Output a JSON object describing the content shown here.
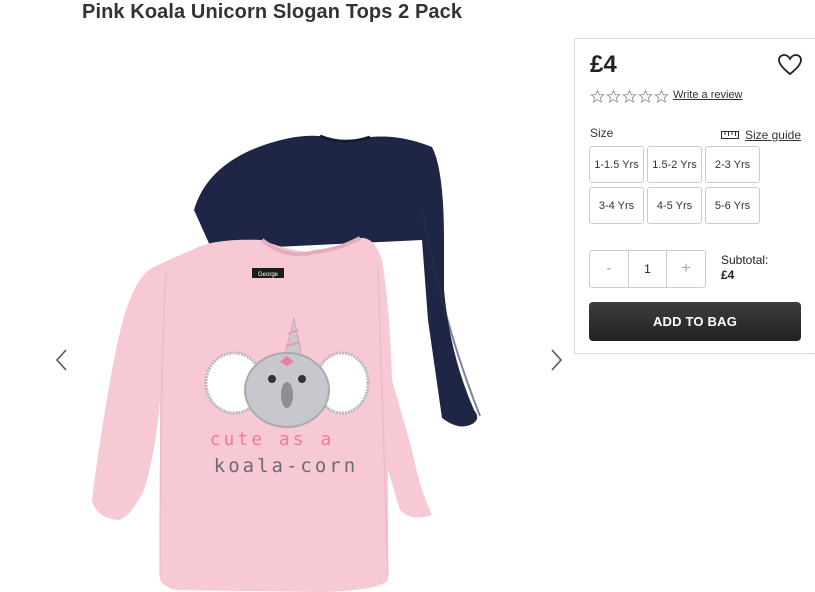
{
  "product": {
    "title": "Pink Koala Unicorn Slogan Tops 2 Pack",
    "image_alt": "Pink Koala Unicorn Slogan Tops 2 Pack",
    "print_line1": "cute as a",
    "print_line2": "koala-corn",
    "label": "George"
  },
  "gallery": {
    "prev_icon": "chevron-left-icon",
    "next_icon": "chevron-right-icon"
  },
  "panel": {
    "price": "£4",
    "wishlist_icon": "heart-icon",
    "rating_stars": 5,
    "rating_value": 0,
    "review_link": "Write a review",
    "size_label": "Size",
    "size_guide_label": "Size guide",
    "size_guide_icon": "ruler-icon",
    "sizes": [
      "1-1.5 Yrs",
      "1.5-2 Yrs",
      "2-3 Yrs",
      "3-4 Yrs",
      "4-5 Yrs",
      "5-6 Yrs"
    ],
    "quantity": {
      "minus": "-",
      "value": "1",
      "plus": "+"
    },
    "subtotal_label": "Subtotal:",
    "subtotal_value": "£4",
    "add_to_bag": "ADD TO BAG"
  },
  "colors": {
    "top_pink": "#f6c9d4",
    "top_navy": "#1f2545",
    "button_dark": "#2b2b2b"
  }
}
